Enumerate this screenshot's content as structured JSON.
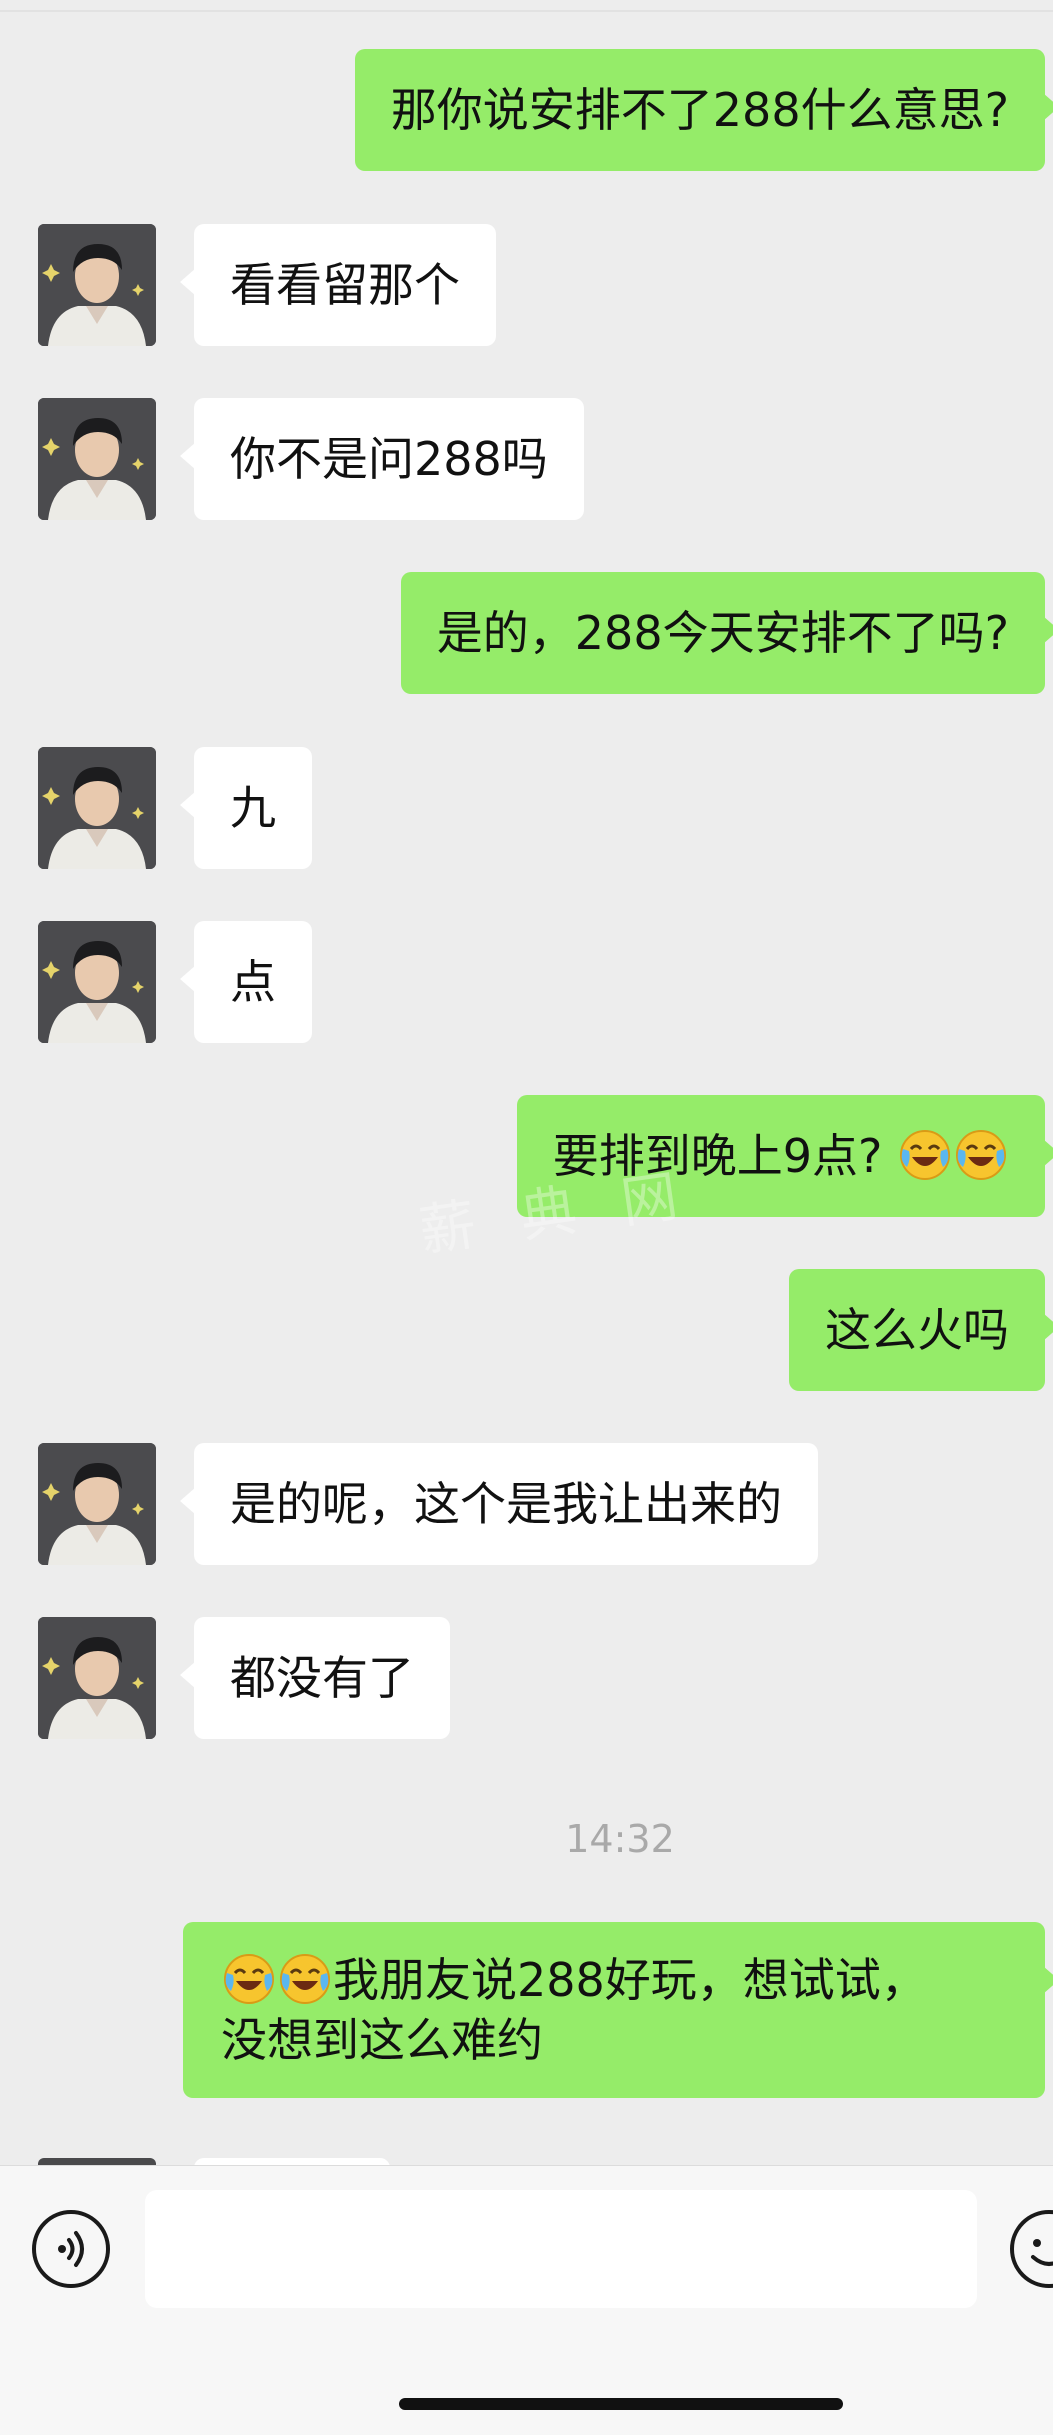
{
  "messages": [
    {
      "side": "out",
      "text": "那你说安排不了288什么意思?"
    },
    {
      "side": "in",
      "text": "看看留那个"
    },
    {
      "side": "in",
      "text": "你不是问288吗"
    },
    {
      "side": "out",
      "text": "是的，288今天安排不了吗?"
    },
    {
      "side": "in",
      "text": "九"
    },
    {
      "side": "in",
      "text": "点"
    },
    {
      "side": "out",
      "text": "要排到晚上9点?"
    },
    {
      "side": "out",
      "text": "这么火吗"
    },
    {
      "side": "in",
      "text": "是的呢，这个是我让出来的"
    },
    {
      "side": "in",
      "text": "都没有了"
    },
    {
      "side": "out",
      "line1": "我朋友说288好玩，想试试，",
      "line2": "没想到这么难约"
    }
  ],
  "timestamp": "14:32",
  "watermark": "薪 典 网",
  "icons": {
    "voice": "voice-icon",
    "emoji": "emoji-face-icon",
    "laugh_cry": "face-with-tears-of-joy-emoji"
  },
  "colors": {
    "background": "#ededed",
    "outgoing_bubble": "#95ec69",
    "incoming_bubble": "#ffffff",
    "timestamp_text": "#a9a9a9"
  }
}
